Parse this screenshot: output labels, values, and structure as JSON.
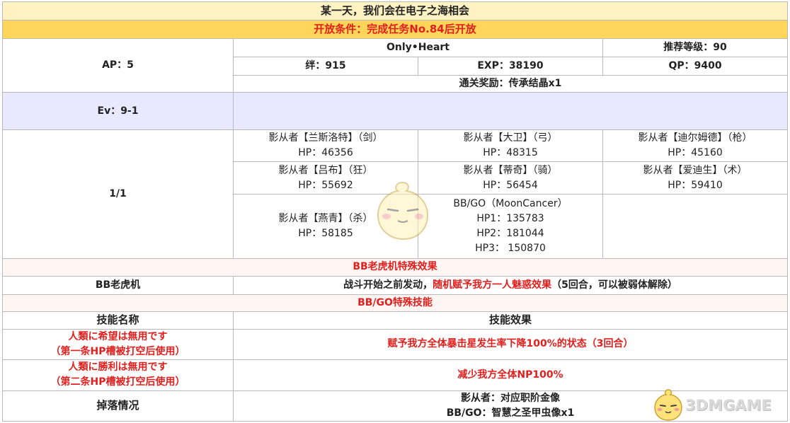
{
  "title": "某一天，我们会在电子之海相会",
  "condition": "开放条件：完成任务No.84后开放",
  "quest": {
    "ap": "AP：5",
    "name": "Only•Heart",
    "level": "推荐等级：90",
    "bond": "绊：915",
    "exp": "EXP：38190",
    "qp": "QP：9400",
    "reward": "通关奖励：传承结晶x1"
  },
  "ev": {
    "label": "Ev：9-1",
    "value": ""
  },
  "wave": {
    "label": "1/1",
    "enemies": [
      {
        "name": "影从者【兰斯洛特】（剑）",
        "hp": "HP：46356"
      },
      {
        "name": "影从者【大卫】（弓）",
        "hp": "HP：48315"
      },
      {
        "name": "影从者【迪尔姆德】（枪）",
        "hp": "HP：45160"
      },
      {
        "name": "影从者【吕布】（狂）",
        "hp": "HP：55692"
      },
      {
        "name": "影从者【蒂奇】（骑）",
        "hp": "HP：56454"
      },
      {
        "name": "影从者【爱迪生】（术）",
        "hp": "HP：59410"
      },
      {
        "name": "影从者【燕青】（杀）",
        "hp": "HP：58185"
      }
    ],
    "boss": {
      "name": "BB/GO（MoonCancer）",
      "hp1": "HP1：135783",
      "hp2": "HP2：181044",
      "hp3": "HP3： 150870"
    }
  },
  "slot": {
    "section_title": "BB老虎机特殊效果",
    "label": "BB老虎机",
    "effect_pre": "战斗开始之前发动，",
    "effect_red": "随机赋予我方一人魅惑效果",
    "effect_post": "（5回合，可以被弱体解除）"
  },
  "skills": {
    "section_title": "BB/GO特殊技能",
    "col_name": "技能名称",
    "col_effect": "技能效果",
    "rows": [
      {
        "name": "人類に希望は無用です",
        "note": "（第一条HP槽被打空后使用）",
        "effect": "赋予我方全体暴击星发生率下降100%的状态（3回合）"
      },
      {
        "name": "人類に勝利は無用です",
        "note": "（第二条HP槽被打空后使用）",
        "effect": "减少我方全体NP100%"
      }
    ]
  },
  "drops": {
    "label": "掉落情况",
    "line1": "影从者：对应职阶金像",
    "line2": "BB/GO：智慧之圣甲虫像x1"
  },
  "watermark": {
    "text": "3DMGAME"
  },
  "colors": {
    "header_bg": "#fff3c4",
    "condition_bg": "#ffd55a",
    "ev_bg": "#e8e8ff",
    "accent_red": "#e0201e"
  }
}
